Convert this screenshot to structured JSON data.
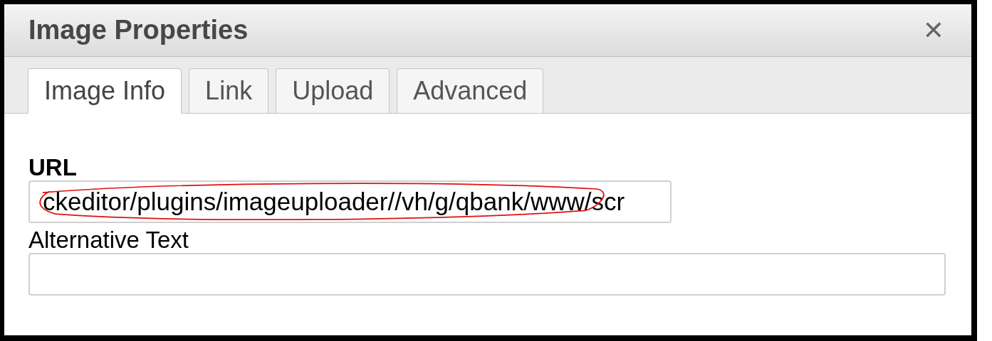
{
  "dialog": {
    "title": "Image Properties",
    "close": "✕"
  },
  "tabs": [
    {
      "label": "Image Info",
      "selected": true
    },
    {
      "label": "Link",
      "selected": false
    },
    {
      "label": "Upload",
      "selected": false
    },
    {
      "label": "Advanced",
      "selected": false
    }
  ],
  "fields": [
    {
      "label": "URL",
      "bold": true,
      "value": "ckeditor/plugins/imageuploader//vh/g/qbank/www/scr",
      "wide": false,
      "circled": true
    },
    {
      "label": "Alternative Text",
      "bold": false,
      "wide": true,
      "circled": false
    }
  ]
}
